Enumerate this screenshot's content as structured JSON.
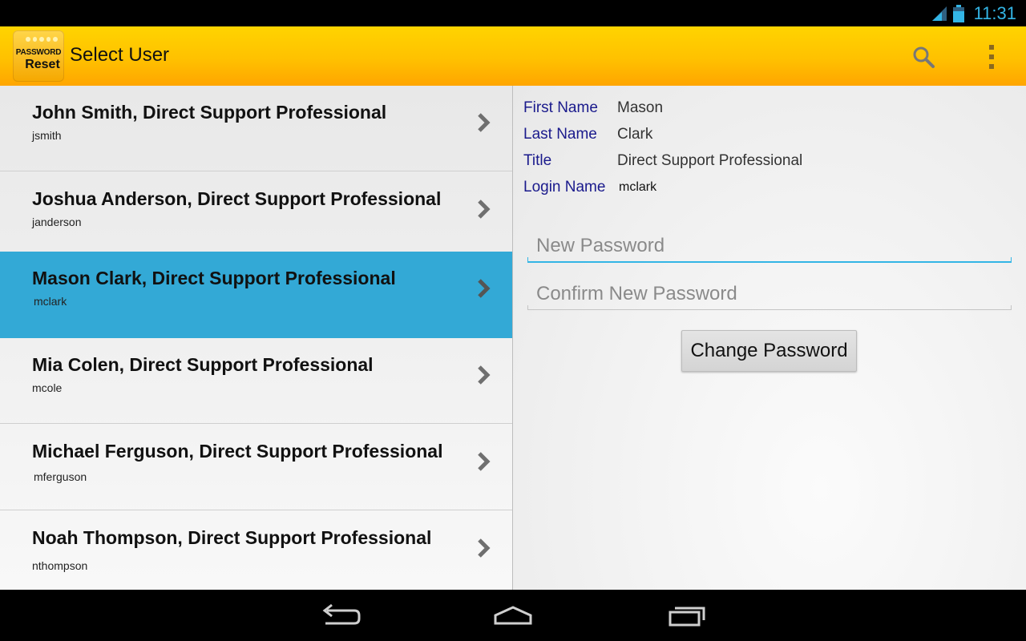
{
  "status_bar": {
    "time": "11:31"
  },
  "action_bar": {
    "logo_top": "PASSWORD",
    "logo_bottom": "Reset",
    "title": "Select User",
    "search_icon": "search-icon",
    "overflow_icon": "overflow-menu-icon"
  },
  "users": [
    {
      "title": "John Smith, Direct Support Professional",
      "login": "jsmith"
    },
    {
      "title": "Joshua Anderson, Direct Support Professional",
      "login": "janderson"
    },
    {
      "title": "Mason Clark, Direct Support Professional",
      "login": "mclark"
    },
    {
      "title": "Mia Colen, Direct Support Professional",
      "login": "mcole"
    },
    {
      "title": "Michael Ferguson, Direct Support Professional",
      "login": "mferguson"
    },
    {
      "title": "Noah Thompson, Direct Support Professional",
      "login": "nthompson"
    }
  ],
  "selected_user_index": 2,
  "detail": {
    "first_name_label": "First Name",
    "first_name": "Mason",
    "last_name_label": "Last Name",
    "last_name": "Clark",
    "title_label": "Title",
    "title": "Direct Support Professional",
    "login_label": "Login Name",
    "login": "mclark",
    "new_password_placeholder": "New Password",
    "new_password_value": "",
    "confirm_password_placeholder": "Confirm New Password",
    "confirm_password_value": "",
    "change_button": "Change Password"
  },
  "colors": {
    "accent": "#33b5e5",
    "selected_row": "#33a9d6",
    "label": "#1a1a8c",
    "action_bar_top": "#ffd400",
    "action_bar_bottom": "#ffa500"
  }
}
